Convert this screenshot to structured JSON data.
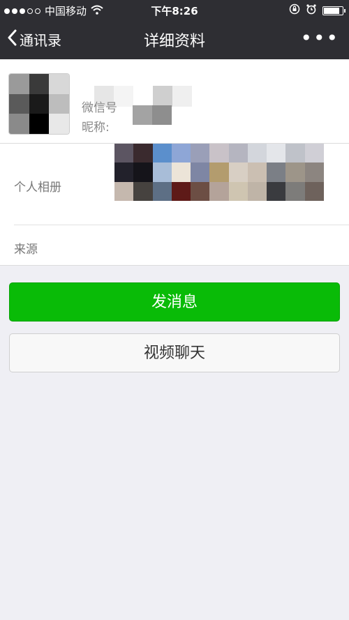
{
  "status_bar": {
    "carrier": "中国移动",
    "time": "下午8:26",
    "battery_level": 0.85
  },
  "nav": {
    "back_label": "通讯录",
    "title": "详细资料",
    "more_label": "•••"
  },
  "profile": {
    "wechat_id_label": "微信号",
    "nickname_label": "昵称:"
  },
  "info": {
    "album_label": "个人相册",
    "source_label": "来源"
  },
  "actions": {
    "send_message": "发消息",
    "video_chat": "视频聊天"
  },
  "colors": {
    "navbar_bg": "#2e2e33",
    "page_bg": "#efeff4",
    "primary_green": "#09bb07"
  },
  "icons": {
    "back": "chevron-left-icon",
    "more": "more-dots-icon",
    "wifi": "wifi-icon",
    "lock_rotation": "rotation-lock-icon",
    "alarm": "alarm-icon",
    "battery": "battery-icon"
  }
}
